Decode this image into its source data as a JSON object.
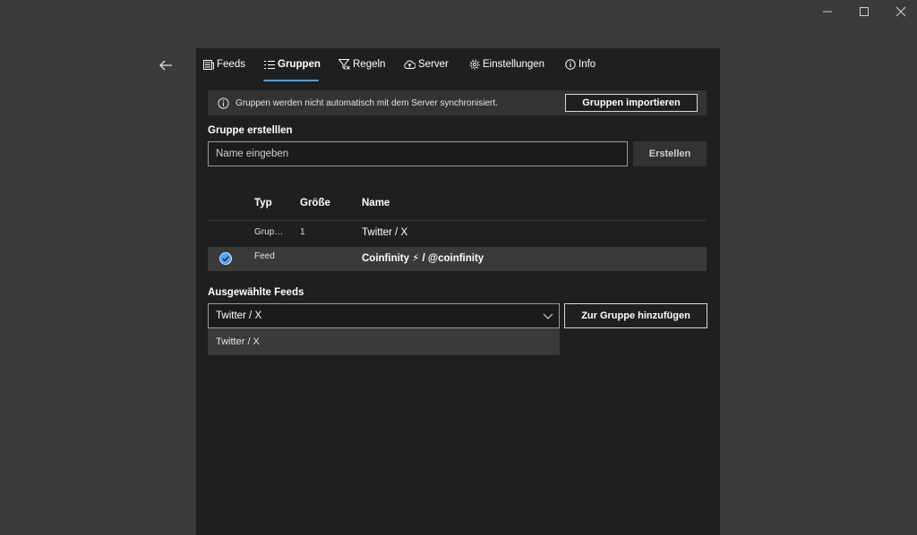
{
  "window_controls": {
    "minimize_icon": "minimize-icon",
    "maximize_icon": "maximize-icon",
    "close_icon": "close-icon"
  },
  "nav": {
    "back_icon": "arrow-left-icon"
  },
  "tabs": [
    {
      "label": "Feeds",
      "icon": "newspaper-icon",
      "active": false
    },
    {
      "label": "Gruppen",
      "icon": "list-icon",
      "active": true
    },
    {
      "label": "Regeln",
      "icon": "filter-icon",
      "active": false
    },
    {
      "label": "Server",
      "icon": "cloud-icon",
      "active": false
    },
    {
      "label": "Einstellungen",
      "icon": "gear-icon",
      "active": false
    },
    {
      "label": "Info",
      "icon": "info-icon",
      "active": false
    }
  ],
  "infobar": {
    "message": "Gruppen werden nicht automatisch mit dem Server synchronisiert.",
    "import_label": "Gruppen importieren"
  },
  "create_group": {
    "label": "Gruppe erstelllen",
    "placeholder": "Name eingeben",
    "button_label": "Erstellen"
  },
  "table": {
    "headers": {
      "type": "Typ",
      "size": "Größe",
      "name": "Name"
    },
    "rows": [
      {
        "type": "Grup…",
        "size": "1",
        "name": "Twitter / X",
        "selected": false
      },
      {
        "type": "Feed",
        "size": "",
        "name": "Coinfinity ⚡ / @coinfinity",
        "selected": true
      }
    ]
  },
  "selected_feeds": {
    "label": "Ausgewählte Feeds",
    "value": "Twitter / X",
    "options": [
      "Twitter / X"
    ],
    "add_label": "Zur Gruppe hinzufügen"
  },
  "colors": {
    "accent": "#4aa3ff",
    "panel_bg": "#1f1f1f",
    "window_bg": "#3b3b3b",
    "selected_row": "#3a3a3a"
  }
}
